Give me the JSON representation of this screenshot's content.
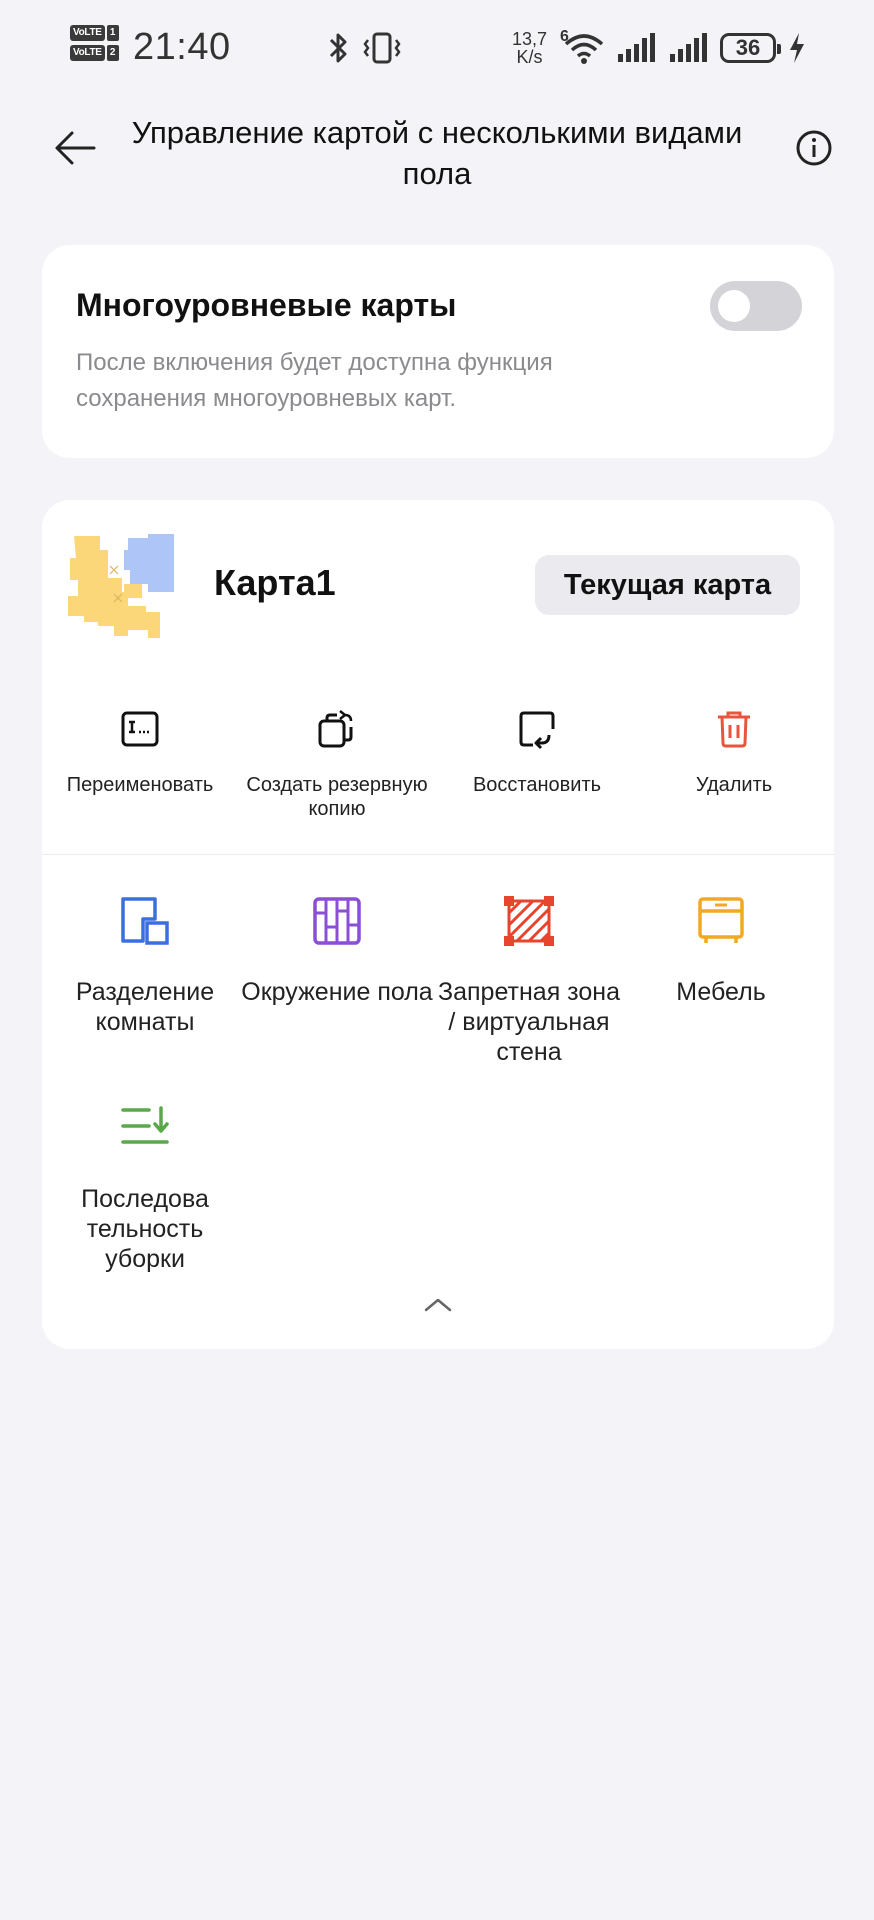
{
  "status_bar": {
    "sim1": {
      "badge": "VoLTE",
      "num": "1"
    },
    "sim2": {
      "badge": "VoLTE",
      "num": "2"
    },
    "time": "21:40",
    "speed_value": "13,7",
    "speed_unit": "K/s",
    "network_type": "6",
    "battery": "36",
    "icons": [
      "bluetooth-icon",
      "vibrate-icon",
      "wifi-icon",
      "signal-icon",
      "signal-icon",
      "battery-icon",
      "charging-icon"
    ]
  },
  "header": {
    "title": "Управление картой с несколькими видами пола"
  },
  "multilevel": {
    "title": "Многоуровневые карты",
    "description": "После включения будет доступна функция сохранения многоуровневых карт.",
    "enabled": false
  },
  "map": {
    "name": "Карта1",
    "current_label": "Текущая карта",
    "actions": [
      {
        "label": "Переименовать",
        "icon": "rename-icon",
        "color": "#111111"
      },
      {
        "label": "Создать резервную копию",
        "icon": "backup-icon",
        "color": "#111111"
      },
      {
        "label": "Восстановить",
        "icon": "restore-icon",
        "color": "#111111"
      },
      {
        "label": "Удалить",
        "icon": "trash-icon",
        "color": "#e8553e"
      }
    ],
    "tools": [
      {
        "label": "Разделение комнаты",
        "icon": "room-split-icon",
        "color": "#3a6fe0"
      },
      {
        "label": "Окружение пола",
        "icon": "floor-material-icon",
        "color": "#8a4fd6"
      },
      {
        "label": "Запретная зона / виртуальная стена",
        "icon": "no-go-zone-icon",
        "color": "#e8452f"
      },
      {
        "label": "Мебель",
        "icon": "furniture-icon",
        "color": "#f2a823"
      },
      {
        "label": "Последова тельность уборки",
        "icon": "cleaning-sequence-icon",
        "color": "#5aa84a"
      }
    ]
  }
}
